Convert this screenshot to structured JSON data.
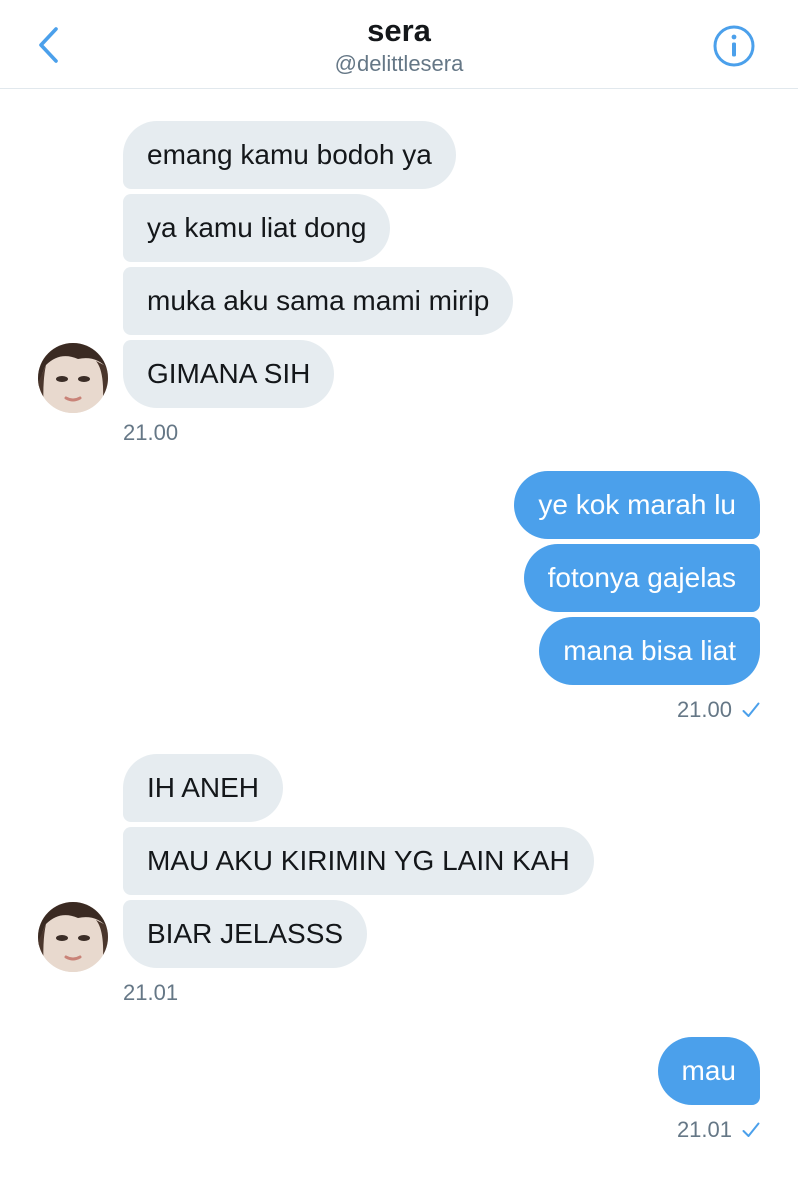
{
  "header": {
    "title": "sera",
    "handle": "@delittlesera"
  },
  "colors": {
    "accent": "#4ba0eb",
    "incoming_bubble": "#e6ecf0",
    "meta_text": "#657786"
  },
  "icons": {
    "back": "chevron-left-icon",
    "info": "info-icon",
    "read": "checkmark-icon"
  },
  "messages": {
    "g1": {
      "m1": "emang kamu bodoh ya",
      "m2": "ya kamu liat dong",
      "m3": "muka aku sama mami mirip",
      "m4": "GIMANA SIH",
      "time": "21.00"
    },
    "g2": {
      "m1": "ye kok marah lu",
      "m2": "fotonya gajelas",
      "m3": "mana bisa liat",
      "time": "21.00"
    },
    "g3": {
      "m1": "IH ANEH",
      "m2": "MAU AKU KIRIMIN YG LAIN KAH",
      "m3": "BIAR JELASSS",
      "time": "21.01"
    },
    "g4": {
      "m1": "mau",
      "time": "21.01"
    }
  }
}
